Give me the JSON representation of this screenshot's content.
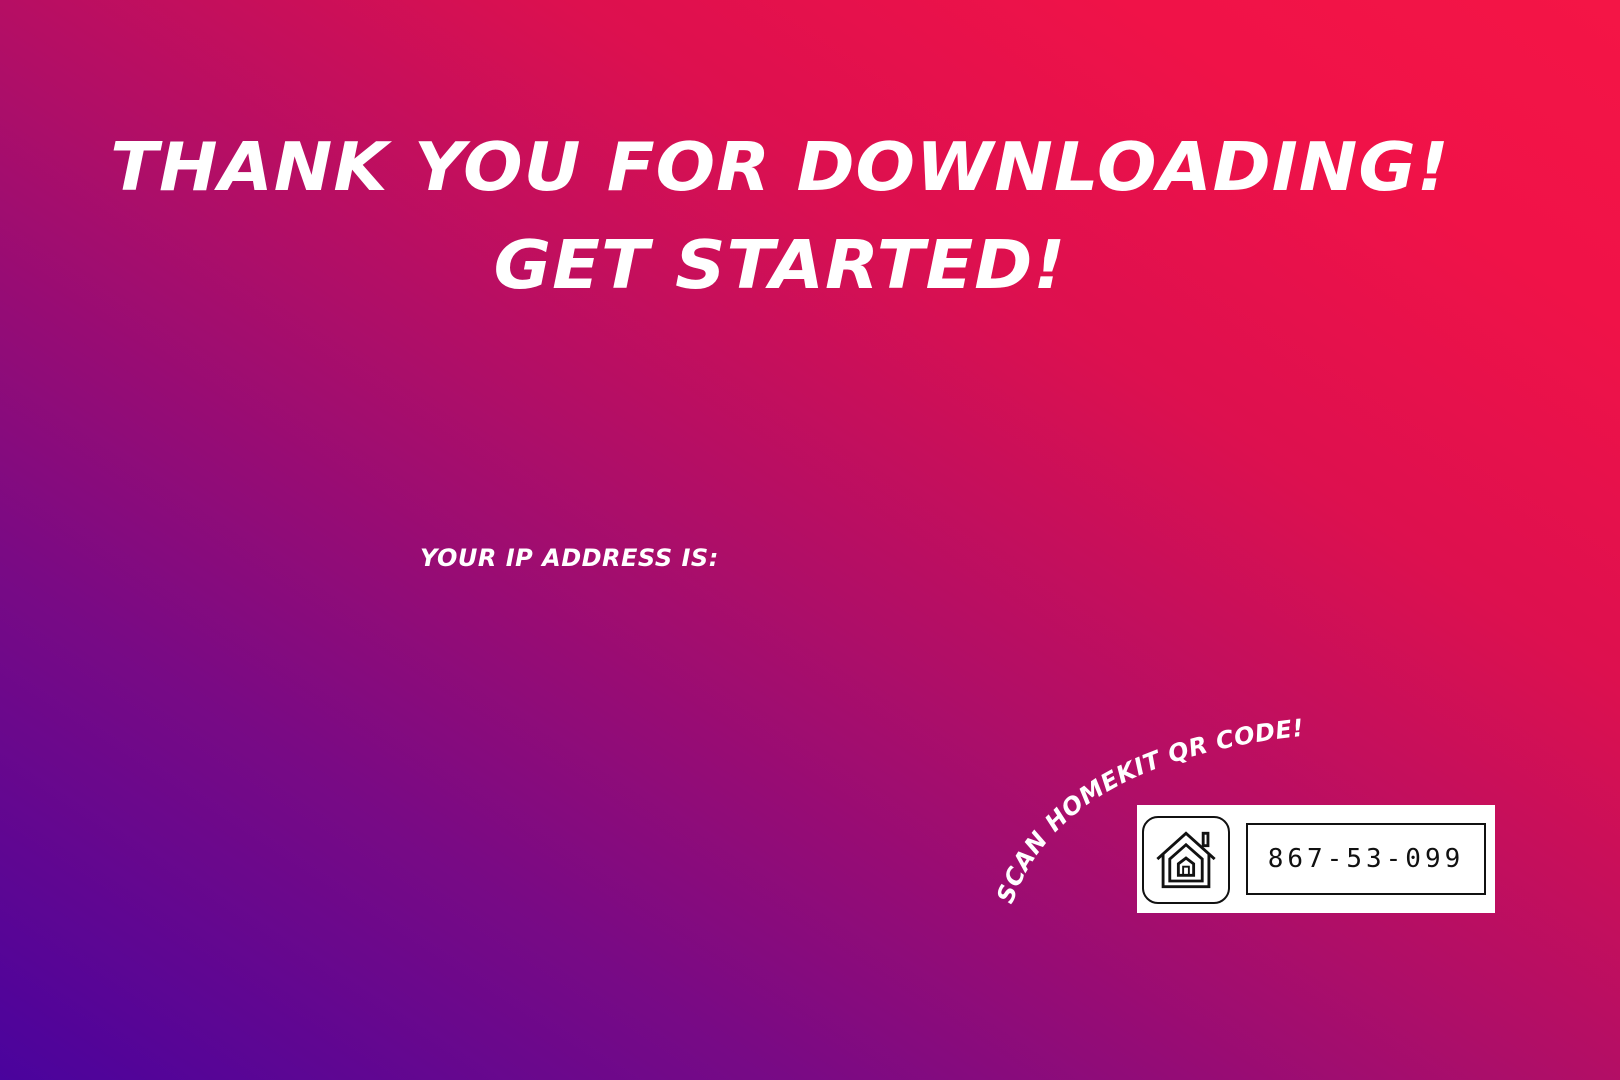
{
  "headline": {
    "line1": "THANK YOU FOR DOWNLOADING!",
    "line2": "GET STARTED!"
  },
  "ip": {
    "label": "YOUR IP ADDRESS IS:",
    "value": ""
  },
  "homekit": {
    "prompt": "SCAN HOMEKIT QR CODE!",
    "setup_code": "867-53-099",
    "icon": "home-icon"
  },
  "colors": {
    "gradient_start": "#4a039d",
    "gradient_mid": "#b00e67",
    "gradient_end": "#f41546",
    "text": "#ffffff",
    "card_background": "#ffffff",
    "card_text": "#111111"
  }
}
